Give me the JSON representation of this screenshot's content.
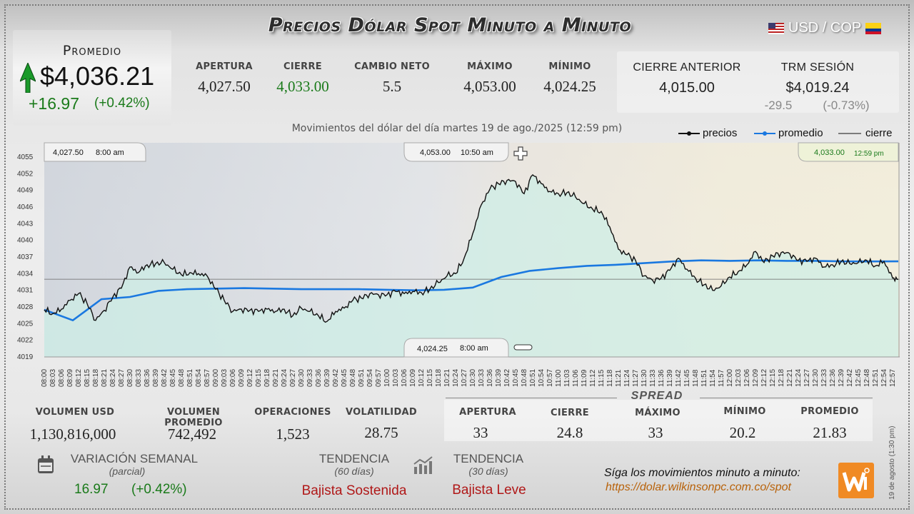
{
  "header": {
    "title": "Precios Dólar Spot Minuto a Minuto",
    "pair": "USD / COP"
  },
  "average": {
    "label": "Promedio",
    "value": "$4,036.21",
    "change": "+16.97",
    "change_pct": "(+0.42%)"
  },
  "stats": [
    {
      "label": "APERTURA",
      "value": "4,027.50",
      "color": "#222222"
    },
    {
      "label": "CIERRE",
      "value": "4,033.00",
      "color": "#1a7a1a"
    },
    {
      "label": "CAMBIO NETO",
      "value": "5.5",
      "color": "#222222"
    },
    {
      "label": "MÁXIMO",
      "value": "4,053.00",
      "color": "#222222"
    },
    {
      "label": "MÍNIMO",
      "value": "4,024.25",
      "color": "#222222"
    }
  ],
  "previous": {
    "close_label": "CIERRE ANTERIOR",
    "close_value": "4,015.00",
    "trm_label": "TRM SESIÓN",
    "trm_value": "$4,019.24",
    "trm_change": "-29.5",
    "trm_pct": "(-0.73%)"
  },
  "caption": "Movimientos del dólar del día martes 19 de ago./2025 (12:59 pm)",
  "chart_data": {
    "type": "line",
    "ylim": [
      4019,
      4055
    ],
    "yticks": [
      "4055",
      "4052",
      "4049",
      "4046",
      "4043",
      "4040",
      "4037",
      "4034",
      "4031",
      "4028",
      "4025",
      "4022",
      "4019"
    ],
    "xticks": [
      "08:00",
      "08:03",
      "08:06",
      "08:09",
      "08:12",
      "08:15",
      "08:18",
      "08:21",
      "08:24",
      "08:27",
      "08:30",
      "08:33",
      "08:36",
      "08:39",
      "08:42",
      "08:45",
      "08:48",
      "08:51",
      "08:54",
      "08:57",
      "09:00",
      "09:03",
      "09:06",
      "09:09",
      "09:12",
      "09:15",
      "09:18",
      "09:21",
      "09:24",
      "09:27",
      "09:30",
      "09:33",
      "09:36",
      "09:39",
      "09:42",
      "09:45",
      "09:48",
      "09:51",
      "09:54",
      "09:57",
      "10:00",
      "10:03",
      "10:06",
      "10:09",
      "10:12",
      "10:15",
      "10:18",
      "10:21",
      "10:24",
      "10:27",
      "10:30",
      "10:33",
      "10:36",
      "10:39",
      "10:42",
      "10:45",
      "10:48",
      "10:51",
      "10:54",
      "10:57",
      "11:00",
      "11:03",
      "11:06",
      "11:09",
      "11:12",
      "11:15",
      "11:18",
      "11:21",
      "11:24",
      "11:27",
      "11:30",
      "11:33",
      "11:36",
      "11:39",
      "11:42",
      "11:45",
      "11:48",
      "11:51",
      "11:54",
      "11:57",
      "12:00",
      "12:03",
      "12:06",
      "12:09",
      "12:12",
      "12:15",
      "12:18",
      "12:21",
      "12:24",
      "12:27",
      "12:30",
      "12:33",
      "12:36",
      "12:39",
      "12:42",
      "12:45",
      "12:48",
      "12:51",
      "12:54",
      "12:57"
    ],
    "xrange_minutes": [
      0,
      299
    ],
    "close_line": 4033.0,
    "legend": [
      {
        "name": "precios",
        "color": "#111111"
      },
      {
        "name": "promedio",
        "color": "#1a78e0"
      },
      {
        "name": "cierre",
        "color": "#111111"
      }
    ],
    "series": [
      {
        "name": "precios",
        "color": "#111111",
        "x": [
          0,
          3,
          6,
          9,
          12,
          15,
          18,
          21,
          24,
          27,
          30,
          33,
          36,
          39,
          42,
          45,
          48,
          51,
          54,
          57,
          60,
          63,
          66,
          69,
          72,
          75,
          78,
          81,
          84,
          87,
          90,
          93,
          96,
          99,
          102,
          105,
          108,
          111,
          114,
          117,
          120,
          123,
          126,
          129,
          132,
          135,
          138,
          141,
          144,
          147,
          150,
          153,
          156,
          159,
          162,
          165,
          168,
          171,
          174,
          177,
          180,
          183,
          186,
          189,
          192,
          195,
          198,
          201,
          204,
          207,
          210,
          213,
          216,
          219,
          222,
          225,
          228,
          231,
          234,
          237,
          240,
          243,
          246,
          249,
          252,
          255,
          258,
          261,
          264,
          267,
          270,
          273,
          276,
          279,
          282,
          285,
          288,
          291,
          294,
          297,
          299
        ],
        "y": [
          4027.5,
          4026.8,
          4027.6,
          4029.2,
          4030.4,
          4028.6,
          4025.6,
          4027.4,
          4029.8,
          4031.4,
          4035.2,
          4034.2,
          4035.6,
          4035.8,
          4036.0,
          4034.8,
          4033.8,
          4034.2,
          4034.0,
          4033.6,
          4031.2,
          4029.2,
          4027.2,
          4027.6,
          4027.4,
          4027.2,
          4027.6,
          4027.2,
          4027.6,
          4026.4,
          4027.8,
          4027.2,
          4026.4,
          4025.4,
          4027.2,
          4027.8,
          4029.2,
          4029.6,
          4030.4,
          4030.2,
          4030.2,
          4030.8,
          4030.4,
          4030.8,
          4030.6,
          4031.2,
          4032.4,
          4033.6,
          4034.0,
          4036.8,
          4041.2,
          4046.4,
          4049.2,
          4050.2,
          4050.8,
          4050.6,
          4048.4,
          4051.8,
          4050.2,
          4048.8,
          4048.4,
          4048.6,
          4047.8,
          4046.6,
          4045.6,
          4045.2,
          4042.4,
          4038.4,
          4037.4,
          4036.4,
          4033.6,
          4032.8,
          4033.2,
          4034.6,
          4036.8,
          4034.8,
          4033.2,
          4032.0,
          4031.0,
          4031.8,
          4033.4,
          4034.4,
          4035.6,
          4038.0,
          4036.0,
          4037.2,
          4037.8,
          4037.6,
          4036.4,
          4036.2,
          4036.8,
          4035.2,
          4035.6,
          4036.2,
          4035.8,
          4036.0,
          4036.4,
          4035.4,
          4036.2,
          4033.2,
          4033.0
        ]
      },
      {
        "name": "promedio",
        "color": "#1a78e0",
        "x": [
          0,
          10,
          20,
          30,
          40,
          50,
          60,
          70,
          80,
          90,
          100,
          110,
          120,
          130,
          140,
          150,
          160,
          170,
          180,
          190,
          200,
          210,
          220,
          230,
          240,
          250,
          260,
          270,
          280,
          290,
          299
        ],
        "y": [
          4027.5,
          4025.6,
          4029.4,
          4029.8,
          4030.9,
          4031.2,
          4031.3,
          4031.4,
          4031.3,
          4031.2,
          4031.2,
          4031.2,
          4031.1,
          4031.0,
          4031.1,
          4031.5,
          4033.4,
          4034.5,
          4035.0,
          4035.4,
          4035.6,
          4035.9,
          4036.2,
          4036.4,
          4036.3,
          4036.4,
          4036.3,
          4036.3,
          4036.2,
          4036.2,
          4036.21
        ]
      }
    ],
    "callouts": [
      {
        "price": "4,027.50",
        "time": "8:00 am"
      },
      {
        "price": "4,053.00",
        "time": "10:50 am"
      },
      {
        "price": "4,033.00",
        "time": "12:59 pm"
      },
      {
        "price": "4,024.25",
        "time": "8:00 am"
      }
    ]
  },
  "bottom_stats": [
    {
      "label": "VOLUMEN USD",
      "value": "1,130,816,000"
    },
    {
      "label": "VOLUMEN PROMEDIO",
      "value": "742,492"
    },
    {
      "label": "OPERACIONES",
      "value": "1,523"
    },
    {
      "label": "VOLATILIDAD",
      "value": "28.75"
    }
  ],
  "spread": {
    "title": "SPREAD",
    "items": [
      {
        "label": "APERTURA",
        "value": "33"
      },
      {
        "label": "CIERRE",
        "value": "24.8"
      },
      {
        "label": "MÁXIMO",
        "value": "33"
      },
      {
        "label": "MÍNIMO",
        "value": "20.2"
      },
      {
        "label": "PROMEDIO",
        "value": "21.83"
      }
    ]
  },
  "weekly": {
    "label": "VARIACIÓN SEMANAL",
    "sub": "(parcial)",
    "value": "16.97",
    "pct": "(+0.42%)"
  },
  "trend60": {
    "label": "TENDENCIA",
    "sub": "(60 días)",
    "value": "Bajista Sostenida"
  },
  "trend30": {
    "label": "TENDENCIA",
    "sub": "(30 días)",
    "value": "Bajista Leve"
  },
  "promo": {
    "line1": "Síga los movimientos minuto a minuto:",
    "url": "https://dolar.wilkinsonpc.com.co/spot"
  },
  "side_note": "19 de agosto (1:30 pm)",
  "icons": {
    "calendar": "calendar-icon",
    "chart": "bar-chart-icon",
    "logo": "wilkinson-logo",
    "up": "up-arrow-icon"
  }
}
